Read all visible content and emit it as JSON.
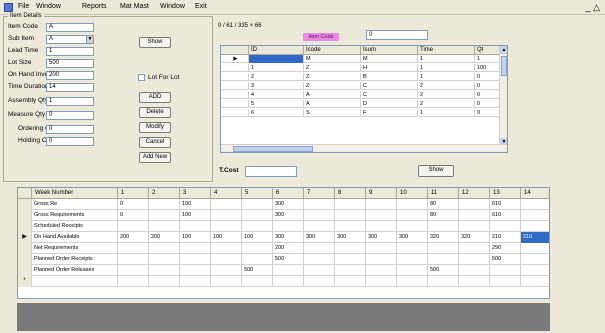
{
  "menu": [
    "File",
    "Window",
    "Reports",
    "Mat Mast",
    "Window",
    "Exit"
  ],
  "group_title": "Item Details",
  "fields": [
    {
      "label": "Item Code",
      "value": "A"
    },
    {
      "label": "Sub Item",
      "value": "A"
    },
    {
      "label": "Lead Time",
      "value": "1"
    },
    {
      "label": "Lot Size",
      "value": "500"
    },
    {
      "label": "On Hand Inventory",
      "value": "200"
    },
    {
      "label": "Time Duration",
      "value": "14"
    },
    {
      "label": "Assembly Qty",
      "value": "1"
    },
    {
      "label": "Measure Qty",
      "value": "0"
    },
    {
      "label": "Ordering Cost",
      "value": "0"
    },
    {
      "label": "Holding Cost",
      "value": "0"
    }
  ],
  "buttons": {
    "show": "Show",
    "add": "ADD",
    "delete": "Delete",
    "modify": "Modify",
    "cancel": "Cancel",
    "add_new": "Add New",
    "show2": "Show"
  },
  "lot_for_lot": "Lot For Lot",
  "coordinate": "0 / 61 / 335 × 66",
  "item_badge": "Item Code",
  "top_input": "0",
  "tcost_label": "T.Cost",
  "grid1": {
    "headers": [
      "ID",
      "Icode",
      "Isum",
      "Time",
      "Qt"
    ],
    "rows": [
      [
        "",
        "M",
        "M",
        "1",
        "1"
      ],
      [
        "1",
        "Z",
        "H",
        "1",
        "100"
      ],
      [
        "2",
        "Z",
        "B",
        "1",
        "0"
      ],
      [
        "3",
        "Z",
        "C",
        "2",
        "0"
      ],
      [
        "4",
        "A",
        "C",
        "2",
        "0"
      ],
      [
        "5",
        "A",
        "D",
        "2",
        "0"
      ],
      [
        "6",
        "S",
        "F",
        "1",
        "0"
      ]
    ]
  },
  "grid2": {
    "headers": [
      "Week Number",
      "1",
      "2",
      "3",
      "4",
      "5",
      "6",
      "7",
      "8",
      "9",
      "10",
      "11",
      "12",
      "13",
      "14"
    ],
    "rows": [
      [
        "Gross Re",
        "0",
        "",
        "100",
        "",
        "",
        "300",
        "",
        "",
        "",
        "",
        "80",
        "",
        "610",
        ""
      ],
      [
        "Gross Requirements",
        "0",
        "",
        "100",
        "",
        "",
        "300",
        "",
        "",
        "",
        "",
        "80",
        "",
        "610",
        ""
      ],
      [
        "Scheduled Receipts",
        "",
        "",
        "",
        "",
        "",
        "",
        "",
        "",
        "",
        "",
        "",
        "",
        "",
        ""
      ],
      [
        "On Hand Available",
        "200",
        "200",
        "100",
        "100",
        "100",
        "300",
        "300",
        "300",
        "300",
        "300",
        "320",
        "320",
        "210",
        "210"
      ],
      [
        "Net Requirements",
        "",
        "",
        "",
        "",
        "",
        "200",
        "",
        "",
        "",
        "",
        "",
        "",
        "290",
        ""
      ],
      [
        "Planned Order Receipts",
        "",
        "",
        "",
        "",
        "",
        "500",
        "",
        "",
        "",
        "",
        "",
        "",
        "500",
        ""
      ],
      [
        "Planned Order Releases",
        "",
        "",
        "",
        "",
        "500",
        "",
        "",
        "",
        "",
        "",
        "500",
        "",
        "",
        ""
      ],
      [
        "",
        "",
        "",
        "",
        "",
        "",
        "",
        "",
        "",
        "",
        "",
        "",
        "",
        "",
        ""
      ]
    ]
  }
}
